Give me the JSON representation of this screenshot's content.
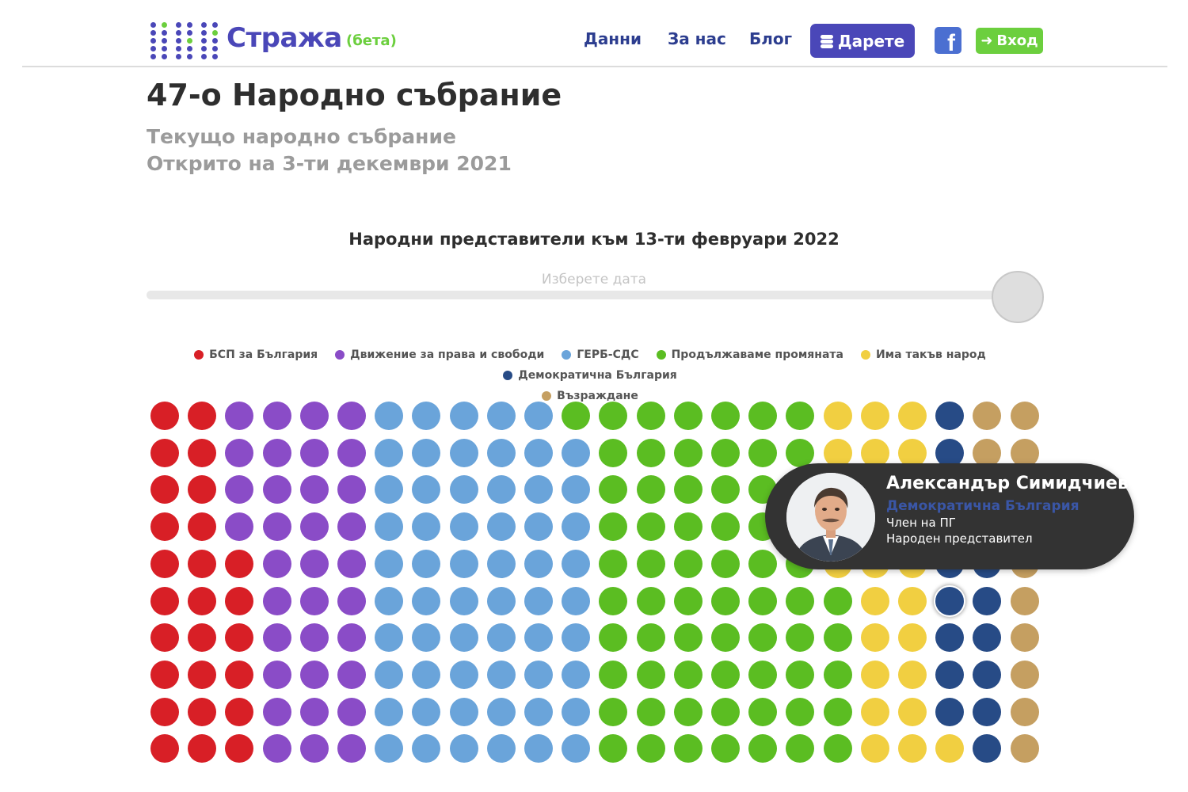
{
  "header": {
    "logo_text": "Стража",
    "logo_beta": "(бета)",
    "nav": {
      "data": "Данни",
      "about": "За нас",
      "blog": "Блог"
    },
    "donate_label": "Дарете",
    "facebook_icon": "facebook-icon",
    "login_label": "Вход",
    "colors": {
      "brand": "#4a47b8",
      "accent": "#6ccf3e",
      "nav": "#2c3d8f"
    }
  },
  "page": {
    "title": "47-о Народно събрание",
    "subtitle_1": "Текущо народно събрание",
    "subtitle_2": "Открито на 3-ти декември 2021"
  },
  "chart": {
    "title": "Народни представители към 13-ти февруари 2022",
    "slider_label": "Изберете дата",
    "slider_value": 1.0
  },
  "legend": [
    {
      "key": "bsp",
      "label": "БСП за България",
      "color": "#d81f26"
    },
    {
      "key": "dps",
      "label": "Движение за права и свободи",
      "color": "#8a4cc7"
    },
    {
      "key": "gerb",
      "label": "ГЕРБ-СДС",
      "color": "#6aa4da"
    },
    {
      "key": "pp",
      "label": "Продължаваме промяната",
      "color": "#5bbd22"
    },
    {
      "key": "itn",
      "label": "Има такъв народ",
      "color": "#f1cf41"
    },
    {
      "key": "db",
      "label": "Демократична България",
      "color": "#274b86"
    },
    {
      "key": "vaz",
      "label": "Възраждане",
      "color": "#c59f61"
    }
  ],
  "seat_grid": {
    "columns": 24,
    "rows": 10,
    "column_parties": [
      [
        "bsp",
        "bsp",
        "bsp",
        "bsp",
        "bsp",
        "bsp",
        "bsp",
        "bsp",
        "bsp",
        "bsp"
      ],
      [
        "bsp",
        "bsp",
        "bsp",
        "bsp",
        "bsp",
        "bsp",
        "bsp",
        "bsp",
        "bsp",
        "bsp"
      ],
      [
        "dps",
        "dps",
        "dps",
        "dps",
        "bsp",
        "bsp",
        "bsp",
        "bsp",
        "bsp",
        "bsp"
      ],
      [
        "dps",
        "dps",
        "dps",
        "dps",
        "dps",
        "dps",
        "dps",
        "dps",
        "dps",
        "dps"
      ],
      [
        "dps",
        "dps",
        "dps",
        "dps",
        "dps",
        "dps",
        "dps",
        "dps",
        "dps",
        "dps"
      ],
      [
        "dps",
        "dps",
        "dps",
        "dps",
        "dps",
        "dps",
        "dps",
        "dps",
        "dps",
        "dps"
      ],
      [
        "gerb",
        "gerb",
        "gerb",
        "gerb",
        "gerb",
        "gerb",
        "gerb",
        "gerb",
        "gerb",
        "gerb"
      ],
      [
        "gerb",
        "gerb",
        "gerb",
        "gerb",
        "gerb",
        "gerb",
        "gerb",
        "gerb",
        "gerb",
        "gerb"
      ],
      [
        "gerb",
        "gerb",
        "gerb",
        "gerb",
        "gerb",
        "gerb",
        "gerb",
        "gerb",
        "gerb",
        "gerb"
      ],
      [
        "gerb",
        "gerb",
        "gerb",
        "gerb",
        "gerb",
        "gerb",
        "gerb",
        "gerb",
        "gerb",
        "gerb"
      ],
      [
        "gerb",
        "gerb",
        "gerb",
        "gerb",
        "gerb",
        "gerb",
        "gerb",
        "gerb",
        "gerb",
        "gerb"
      ],
      [
        "pp",
        "gerb",
        "gerb",
        "gerb",
        "gerb",
        "gerb",
        "gerb",
        "gerb",
        "gerb",
        "gerb"
      ],
      [
        "pp",
        "pp",
        "pp",
        "pp",
        "pp",
        "pp",
        "pp",
        "pp",
        "pp",
        "pp"
      ],
      [
        "pp",
        "pp",
        "pp",
        "pp",
        "pp",
        "pp",
        "pp",
        "pp",
        "pp",
        "pp"
      ],
      [
        "pp",
        "pp",
        "pp",
        "pp",
        "pp",
        "pp",
        "pp",
        "pp",
        "pp",
        "pp"
      ],
      [
        "pp",
        "pp",
        "pp",
        "pp",
        "pp",
        "pp",
        "pp",
        "pp",
        "pp",
        "pp"
      ],
      [
        "pp",
        "pp",
        "pp",
        "pp",
        "pp",
        "pp",
        "pp",
        "pp",
        "pp",
        "pp"
      ],
      [
        "pp",
        "pp",
        "pp",
        "pp",
        "pp",
        "pp",
        "pp",
        "pp",
        "pp",
        "pp"
      ],
      [
        "itn",
        "itn",
        "itn",
        "itn",
        "itn",
        "pp",
        "pp",
        "pp",
        "pp",
        "pp"
      ],
      [
        "itn",
        "itn",
        "itn",
        "itn",
        "itn",
        "itn",
        "itn",
        "itn",
        "itn",
        "itn"
      ],
      [
        "itn",
        "itn",
        "itn",
        "itn",
        "itn",
        "itn",
        "itn",
        "itn",
        "itn",
        "itn"
      ],
      [
        "db",
        "db",
        "db",
        "db",
        "db",
        "db",
        "db",
        "db",
        "db",
        "itn"
      ],
      [
        "vaz",
        "vaz",
        "db",
        "db",
        "db",
        "db",
        "db",
        "db",
        "db",
        "db"
      ],
      [
        "vaz",
        "vaz",
        "vaz",
        "vaz",
        "vaz",
        "vaz",
        "vaz",
        "vaz",
        "vaz",
        "vaz"
      ]
    ],
    "hovered_seat": {
      "column": 21,
      "row": 5
    }
  },
  "tooltip": {
    "name": "Александър Симидчиев",
    "party": "Демократична България",
    "role_1": "Член на ПГ",
    "role_2": "Народен представител",
    "photo_icon": "person-photo"
  }
}
